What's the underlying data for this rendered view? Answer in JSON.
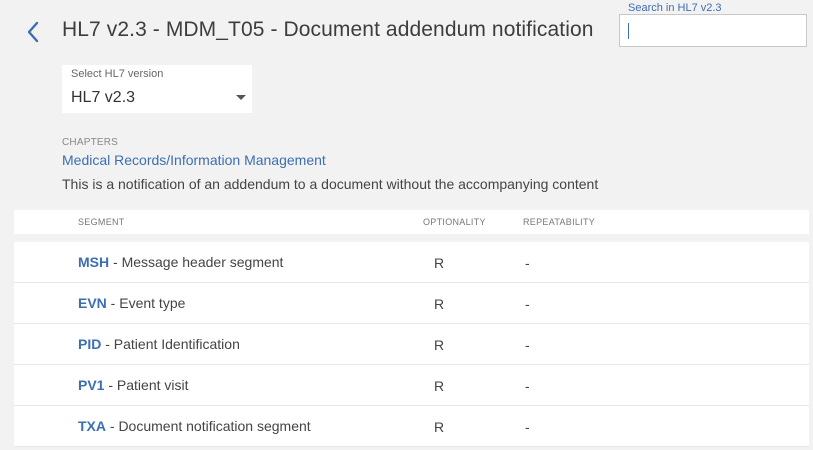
{
  "header": {
    "title": "HL7 v2.3 - MDM_T05 - Document addendum notification",
    "back_icon": "chevron-left-icon"
  },
  "search": {
    "label": "Search in HL7 v2.3",
    "value": ""
  },
  "version_select": {
    "label": "Select HL7 version",
    "value": "HL7 v2.3"
  },
  "chapters": {
    "label": "CHAPTERS",
    "link": "Medical Records/Information Management",
    "description": "This is a notification of an addendum to a document without the accompanying content"
  },
  "table": {
    "headers": {
      "segment": "SEGMENT",
      "optionality": "OPTIONALITY",
      "repeatability": "REPEATABILITY"
    },
    "rows": [
      {
        "code": "MSH",
        "desc": " - Message header segment",
        "opt": "R",
        "rep": "-"
      },
      {
        "code": "EVN",
        "desc": " - Event type",
        "opt": "R",
        "rep": "-"
      },
      {
        "code": "PID",
        "desc": " - Patient Identification",
        "opt": "R",
        "rep": "-"
      },
      {
        "code": "PV1",
        "desc": " - Patient visit",
        "opt": "R",
        "rep": "-"
      },
      {
        "code": "TXA",
        "desc": " - Document notification segment",
        "opt": "R",
        "rep": "-"
      }
    ]
  },
  "colors": {
    "accent": "#3c6eb4",
    "background": "#f2f2f2"
  }
}
